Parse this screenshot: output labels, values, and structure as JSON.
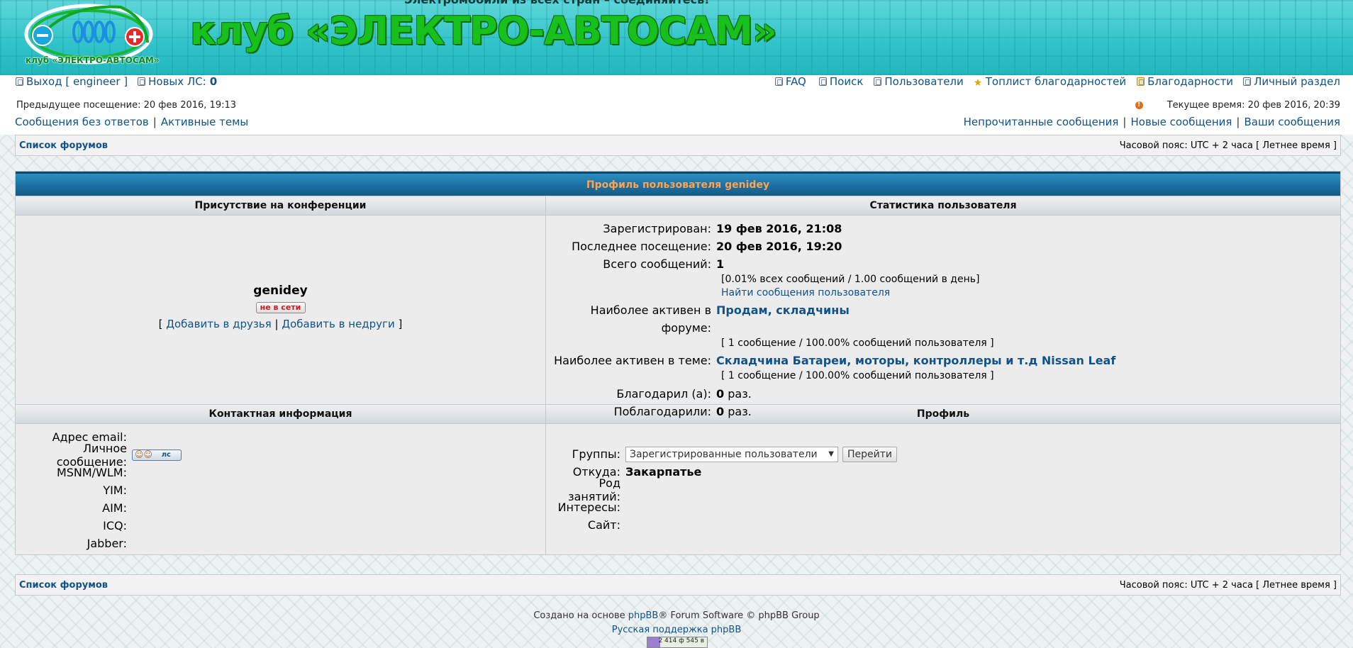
{
  "banner": {
    "top_text": "Электромобили из всех стран – соединяйтесь!",
    "title": "клуб «ЭЛЕКТРО-АВТОСАМ»",
    "logo_caption": "клуб «ЭЛЕКТРО-АВТОСАМ»"
  },
  "topnav": {
    "logout": "Выход [ engineer ]",
    "new_pm_label": "Новых ЛС:",
    "new_pm_count": "0",
    "faq": "FAQ",
    "search": "Поиск",
    "members": "Пользователи",
    "thanks_top": "Топлист благодарностей",
    "thanks": "Благодарности",
    "ucp": "Личный раздел",
    "last_visit": "Предыдущее посещение: 20 фев 2016, 19:13",
    "current_time": "Текущее время: 20 фев 2016, 20:39",
    "unanswered": "Сообщения без ответов",
    "active": "Активные темы",
    "unread": "Непрочитанные сообщения",
    "new_posts": "Новые сообщения",
    "your_posts": "Ваши сообщения"
  },
  "breadcrumb": {
    "forum_index": "Список форумов",
    "timezone": "Часовой пояс: UTC + 2 часа [ Летнее время ]"
  },
  "profile": {
    "title": "Профиль пользователя genidey",
    "presence_header": "Присутствие на конференции",
    "stats_header": "Статистика пользователя",
    "username": "genidey",
    "status": "не в сети",
    "add_friend": "Добавить в друзья",
    "add_foe": "Добавить в недруги",
    "stats": {
      "registered_label": "Зарегистрирован:",
      "registered": "19 фев 2016, 21:08",
      "last_visit_label": "Последнее посещение:",
      "last_visit": "20 фев 2016, 19:20",
      "posts_label": "Всего сообщений:",
      "posts": "1",
      "posts_pct": "[0.01% всех сообщений / 1.00 сообщений в день]",
      "search_posts": "Найти сообщения пользователя",
      "active_forum_label": "Наиболее активен в форуме:",
      "active_forum": "Продам, складчины",
      "active_forum_info": "[ 1 сообщение / 100.00% сообщений пользователя ]",
      "active_topic_label": "Наиболее активен в теме:",
      "active_topic": "Складчина Батареи, моторы, контроллеры и т.д Nissan Leaf",
      "active_topic_info": "[ 1 сообщение / 100.00% сообщений пользователя ]",
      "thanked_label": "Благодарил (а):",
      "thanked": "0",
      "thanked_by_label": "Поблагодарили:",
      "thanked_by": "0",
      "times": "раз."
    },
    "contact_header": "Контактная информация",
    "profile_header": "Профиль",
    "contact": {
      "email_label": "Адрес email:",
      "pm_label": "Личное сообщение:",
      "pm_button": "лс",
      "msnm_label": "MSNM/WLM:",
      "yim_label": "YIM:",
      "aim_label": "AIM:",
      "icq_label": "ICQ:",
      "jabber_label": "Jabber:"
    },
    "details": {
      "groups_label": "Группы:",
      "groups_value": "Зарегистрированные пользователи",
      "go_button": "Перейти",
      "location_label": "Откуда:",
      "location": "Закарпатье",
      "occupation_label": "Род занятий:",
      "interests_label": "Интересы:",
      "website_label": "Сайт:"
    }
  },
  "footer": {
    "powered_prefix": "Создано на основе",
    "phpbb": "phpBB",
    "powered_suffix": "® Forum Software © phpBB Group",
    "ru_support": "Русская поддержка phpBB",
    "counter": "2 414 ф 545 в"
  },
  "colors": {
    "link": "#105289",
    "title_text": "#ffa34f",
    "banner_title": "#17c01c",
    "offline": "#d0161b"
  }
}
